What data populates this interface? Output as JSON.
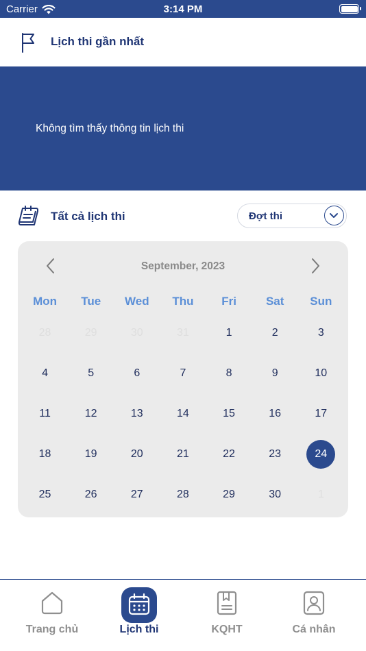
{
  "status_bar": {
    "carrier": "Carrier",
    "time": "3:14 PM"
  },
  "header": {
    "title": "Lịch thi gần nhất",
    "icon": "flag-icon"
  },
  "banner": {
    "message": "Không tìm thấy thông tin lịch thi"
  },
  "section": {
    "title": "Tất cả lịch thi",
    "icon": "calendar-note-icon",
    "dropdown": {
      "selected": "Đợt thi"
    }
  },
  "calendar": {
    "month_label": "September, 2023",
    "weekdays": [
      "Mon",
      "Tue",
      "Wed",
      "Thu",
      "Fri",
      "Sat",
      "Sun"
    ],
    "selected_day": "24",
    "weeks": [
      [
        {
          "d": "28",
          "muted": true
        },
        {
          "d": "29",
          "muted": true
        },
        {
          "d": "30",
          "muted": true
        },
        {
          "d": "31",
          "muted": true
        },
        {
          "d": "1"
        },
        {
          "d": "2"
        },
        {
          "d": "3"
        }
      ],
      [
        {
          "d": "4"
        },
        {
          "d": "5"
        },
        {
          "d": "6"
        },
        {
          "d": "7"
        },
        {
          "d": "8"
        },
        {
          "d": "9"
        },
        {
          "d": "10"
        }
      ],
      [
        {
          "d": "11"
        },
        {
          "d": "12"
        },
        {
          "d": "13"
        },
        {
          "d": "14"
        },
        {
          "d": "15"
        },
        {
          "d": "16"
        },
        {
          "d": "17"
        }
      ],
      [
        {
          "d": "18"
        },
        {
          "d": "19"
        },
        {
          "d": "20"
        },
        {
          "d": "21"
        },
        {
          "d": "22"
        },
        {
          "d": "23"
        },
        {
          "d": "24",
          "selected": true
        }
      ],
      [
        {
          "d": "25"
        },
        {
          "d": "26"
        },
        {
          "d": "27"
        },
        {
          "d": "28"
        },
        {
          "d": "29"
        },
        {
          "d": "30"
        },
        {
          "d": "1",
          "muted": true
        }
      ]
    ]
  },
  "tabs": [
    {
      "label": "Trang chủ",
      "icon": "home-icon",
      "active": false
    },
    {
      "label": "Lịch thi",
      "icon": "calendar-icon",
      "active": true
    },
    {
      "label": "KQHT",
      "icon": "bookmark-book-icon",
      "active": false
    },
    {
      "label": "Cá nhân",
      "icon": "profile-icon",
      "active": false
    }
  ],
  "colors": {
    "primary": "#2b4a8e",
    "heading": "#1f3574",
    "weekday": "#5b8fd7",
    "inactive_tab": "#8f8f8f",
    "calendar_bg": "#ebebeb"
  }
}
